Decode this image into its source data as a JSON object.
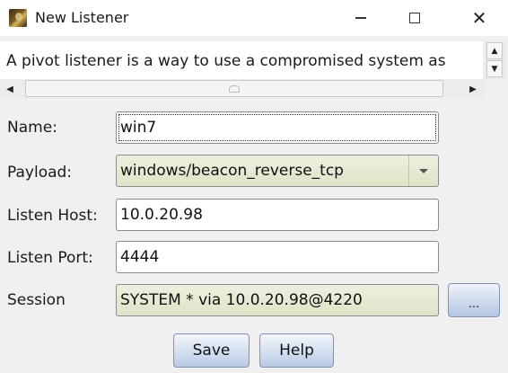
{
  "window": {
    "title": "New Listener",
    "controls": {
      "minimize": "minimize",
      "maximize": "maximize",
      "close": "✕"
    }
  },
  "description": {
    "text": "A pivot listener is a way to use a compromised system as"
  },
  "scrollbars": {
    "up": "▲",
    "down": "▼",
    "left": "◀",
    "right": "▶"
  },
  "form": {
    "name": {
      "label": "Name:",
      "value": "win7"
    },
    "payload": {
      "label": "Payload:",
      "value": "windows/beacon_reverse_tcp"
    },
    "listen_host": {
      "label": "Listen Host:",
      "value": "10.0.20.98"
    },
    "listen_port": {
      "label": "Listen Port:",
      "value": "4444"
    },
    "session": {
      "label": "Session",
      "value": "SYSTEM * via  10.0.20.98@4220",
      "browse_label": "..."
    }
  },
  "buttons": {
    "save": "Save",
    "help": "Help"
  },
  "colors": {
    "olive_field": "#dfe3c7",
    "button_blue": "#bac9e3"
  }
}
